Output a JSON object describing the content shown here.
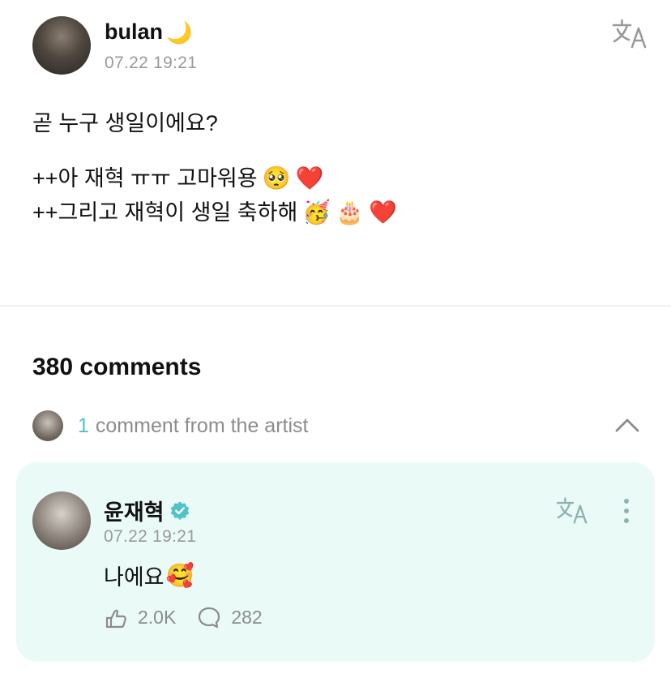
{
  "post": {
    "author": "bulan",
    "author_emoji": "🌙",
    "time": "07.22 19:21",
    "line1": "곧 누구 생일이에요?",
    "line2": "++아 재혁 ㅠㅠ 고마워용",
    "line2_emojis": [
      "🥺",
      "❤️"
    ],
    "line3": "++그리고 재혁이 생일 축하해",
    "line3_emojis": [
      "🥳",
      "🎂",
      "❤️"
    ]
  },
  "comments": {
    "count_label": "380 comments",
    "artist_count": "1",
    "artist_label": "comment from the artist"
  },
  "artist_comment": {
    "name": "윤재혁",
    "time": "07.22 19:21",
    "text": "나에요",
    "text_emoji": "🥰",
    "likes": "2.0K",
    "replies": "282"
  },
  "colors": {
    "accent": "#4fc3c9",
    "card_bg": "#eafaf7",
    "muted": "#8c8c8c",
    "verified": "#4fc3c9"
  },
  "icons": {
    "translate": "translate-icon",
    "more": "more-vertical-icon",
    "chevron": "chevron-up-icon",
    "like": "like-hand-icon",
    "reply": "comment-bubble-icon",
    "verified": "verified-badge-icon"
  }
}
